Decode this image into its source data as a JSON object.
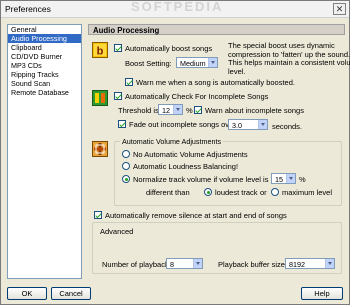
{
  "window": {
    "title": "Preferences",
    "watermark": "SOFTPEDIA"
  },
  "sidebar": {
    "items": [
      {
        "label": "General"
      },
      {
        "label": "Audio Processing"
      },
      {
        "label": "Clipboard"
      },
      {
        "label": "CD/DVD Burner"
      },
      {
        "label": "MP3 CDs"
      },
      {
        "label": "Ripping Tracks"
      },
      {
        "label": "Sound Scan"
      },
      {
        "label": "Remote Database"
      }
    ],
    "selected_index": 1
  },
  "panel": {
    "title": "Audio Processing",
    "boost": {
      "checkbox_label": "Automatically boost songs",
      "checked": true,
      "setting_label": "Boost Setting:",
      "setting_value": "Medium",
      "description": [
        "The special boost uses dynamic",
        "compression to 'fatten' up the sound.",
        "This helps maintain a consistent volume",
        "level."
      ],
      "warn_label": "Warn me when a song is automatically boosted.",
      "warn_checked": true
    },
    "incomplete": {
      "checkbox_label": "Automatically Check For Incomplete Songs",
      "checked": true,
      "threshold_label": "Threshold is:",
      "threshold_value": "12",
      "threshold_unit": "%",
      "warn_label": "Warn about incomplete songs",
      "warn_checked": true,
      "fade_label": "Fade out incomplete songs over",
      "fade_checked": true,
      "fade_value": "3.0",
      "fade_unit": "seconds."
    },
    "volume": {
      "group_title": "Automatic Volume Adjustments",
      "opt_none": "No Automatic Volume Adjustments",
      "opt_loudness": "Automatic Loudness Balancing!",
      "opt_normalize": "Normalize track volume if volume level is",
      "normalize_value": "15",
      "normalize_unit": "%",
      "different_than": "different than",
      "opt_loudest": "loudest track",
      "or_text": "or",
      "opt_maximum": "maximum level",
      "selected": "normalize",
      "sub_selected": "loudest"
    },
    "silence": {
      "label": "Automatically remove silence at start and end of songs",
      "checked": true
    },
    "advanced": {
      "title": "Advanced",
      "playback_label": "Number of playback",
      "playback_value": "8",
      "buffer_label": "Playback buffer size :",
      "buffer_value": "8192"
    }
  },
  "buttons": {
    "ok": "OK",
    "cancel": "Cancel",
    "help": "Help"
  },
  "colors": {
    "selection": "#316ac5",
    "check": "#21a121",
    "window_bg": "#ece9d8"
  }
}
